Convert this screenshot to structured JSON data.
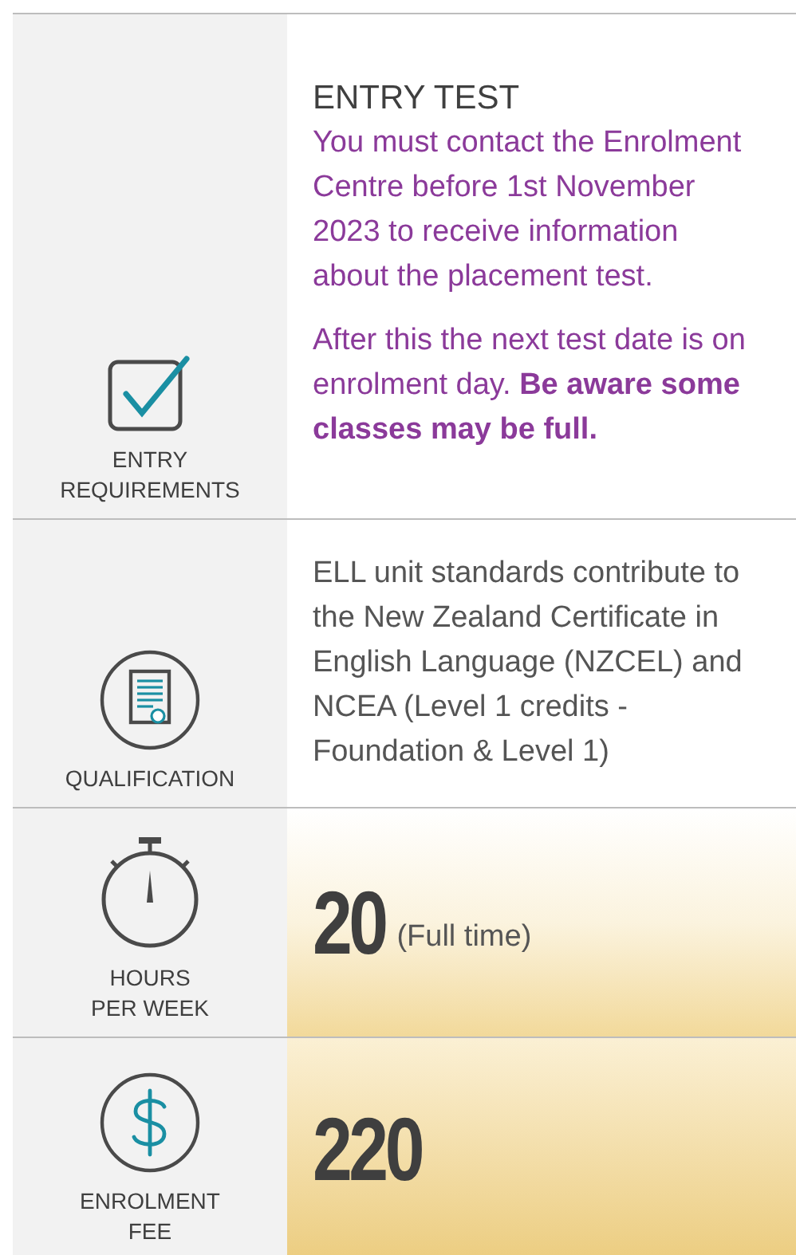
{
  "rows": [
    {
      "kind": "notice",
      "label_lines": [
        "ENTRY",
        "REQUIREMENTS"
      ],
      "heading": "ENTRY TEST",
      "paragraphs": [
        "You must contact the Enrolment Centre before 1st November 2023 to receive information about the placement test.",
        "After this the next test date is on enrolment day. **Be aware some classes may be full.**"
      ]
    },
    {
      "kind": "text",
      "label_lines": [
        "QUALIFICATION"
      ],
      "paragraphs": [
        "ELL unit standards contribute to the New Zealand Certificate in English Language (NZCEL) and NCEA (Level 1 credits - Foundation & Level 1)"
      ]
    },
    {
      "kind": "figure",
      "label_lines": [
        "HOURS",
        "PER WEEK"
      ],
      "value": "20",
      "note": "(Full time)"
    },
    {
      "kind": "figure",
      "label_lines": [
        "ENROLMENT",
        "FEE"
      ],
      "value": "220"
    }
  ]
}
